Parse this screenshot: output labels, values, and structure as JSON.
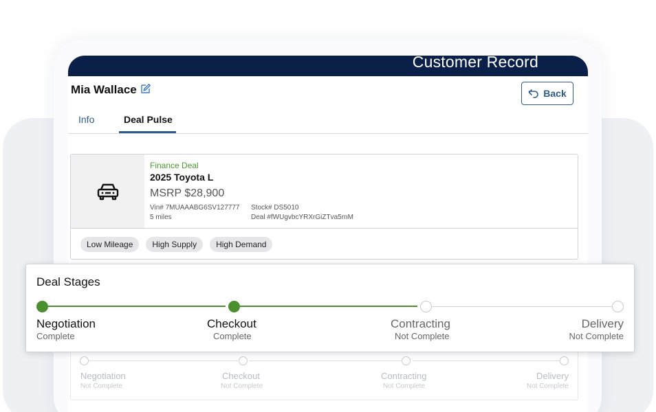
{
  "header": {
    "title": "Customer Record"
  },
  "customer": {
    "name": "Mia Wallace",
    "edit_icon": "pencil-icon"
  },
  "back_button": {
    "label": "Back",
    "icon": "back-arrow-icon"
  },
  "tabs": [
    {
      "label": "Info",
      "active": false
    },
    {
      "label": "Deal Pulse",
      "active": true
    }
  ],
  "vehicle": {
    "icon": "car-icon",
    "deal_type": "Finance Deal",
    "name": "2025 Toyota L",
    "msrp": "MSRP $28,900",
    "vin": "Vin# 7MUAAABG6SV127777",
    "mileage": "5 miles",
    "stock": "Stock# DS5010",
    "deal_number": "Deal #fWUgvbcYRXrGiZTva5rnM",
    "tags": [
      "Low Mileage",
      "High Supply",
      "High Demand"
    ]
  },
  "deal_stages": {
    "title": "Deal Stages",
    "accent_color": "#4a8f2e",
    "stages": [
      {
        "name": "Negotiation",
        "status": "Complete",
        "complete": true
      },
      {
        "name": "Checkout",
        "status": "Complete",
        "complete": true
      },
      {
        "name": "Contracting",
        "status": "Not Complete",
        "complete": false
      },
      {
        "name": "Delivery",
        "status": "Not Complete",
        "complete": false
      }
    ]
  },
  "background_stages": [
    {
      "name": "Negotiation",
      "status": "Not Complete"
    },
    {
      "name": "Checkout",
      "status": "Not Complete"
    },
    {
      "name": "Contracting",
      "status": "Not Complete"
    },
    {
      "name": "Delivery",
      "status": "Not Complete"
    }
  ],
  "colors": {
    "header_bg": "#0b2048",
    "link_blue": "#2f5a8c",
    "deal_green": "#4a9a2e"
  }
}
